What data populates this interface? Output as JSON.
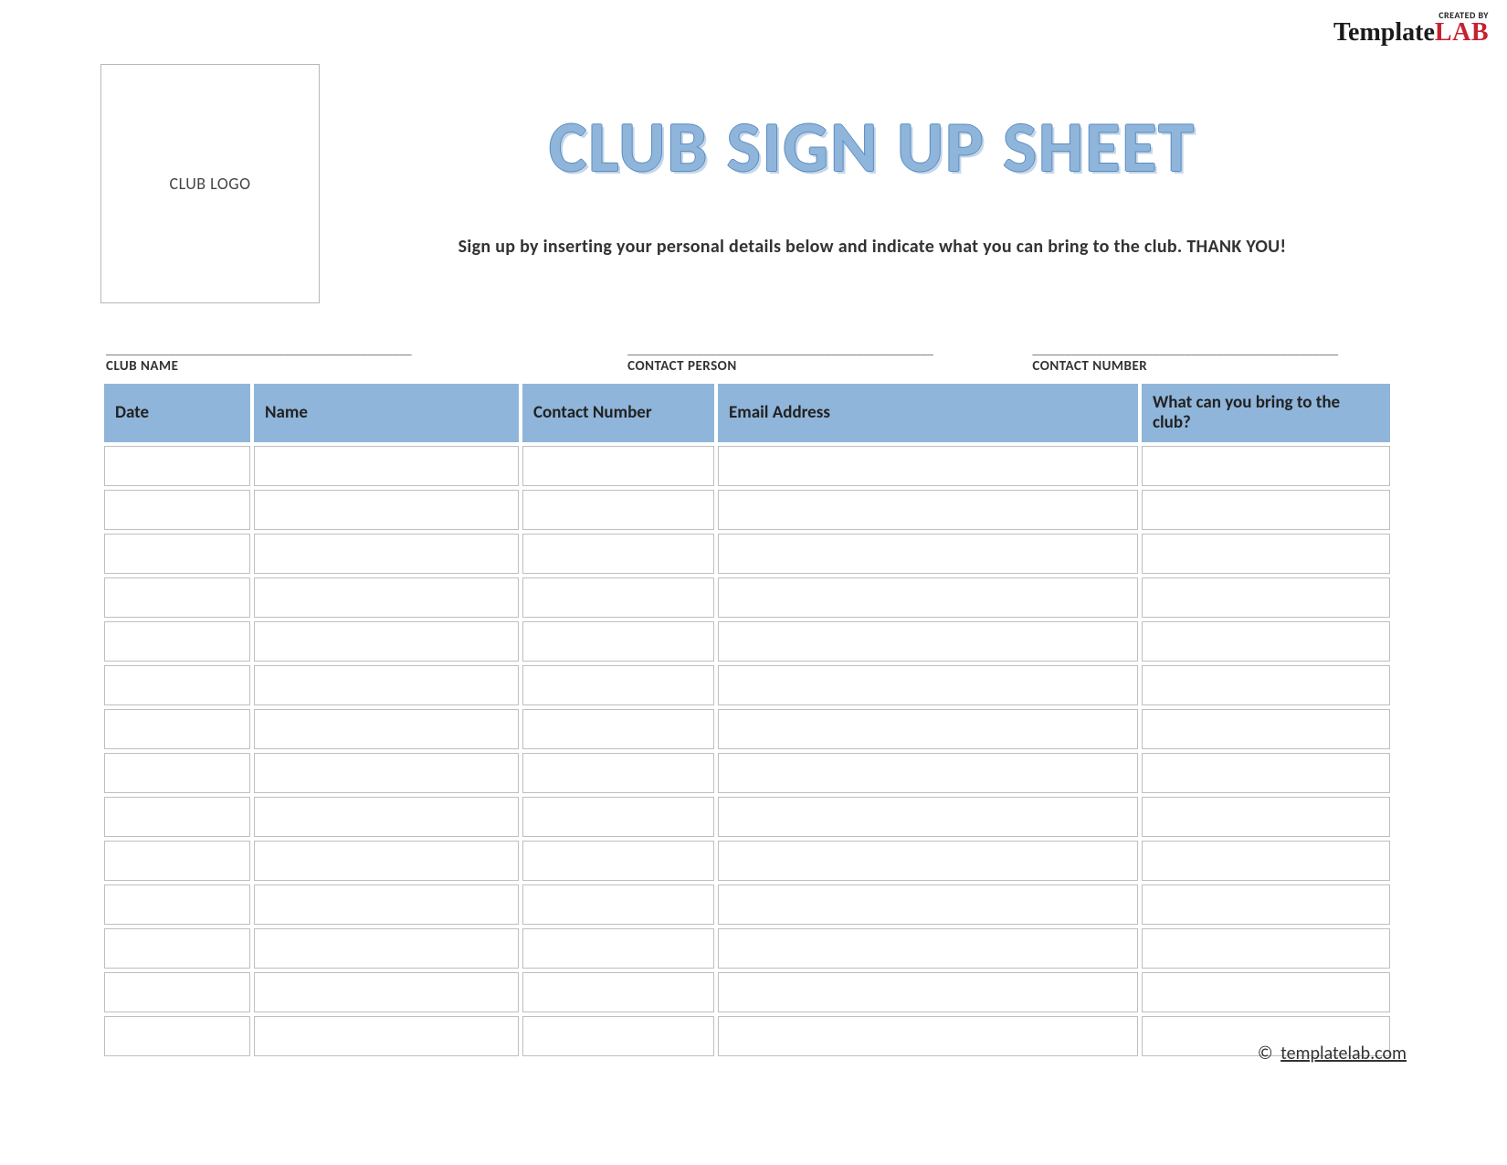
{
  "watermark": {
    "created_by": "CREATED BY",
    "brand_main": "Template",
    "brand_accent": "LAB"
  },
  "header": {
    "logo_placeholder": "CLUB LOGO",
    "title": "CLUB SIGN UP SHEET",
    "instruction": "Sign up by inserting your personal details below and indicate what you can bring to the club. THANK YOU!"
  },
  "meta": {
    "blank_line": "________________________________________________",
    "club_name_label": "CLUB NAME",
    "contact_person_label": "CONTACT PERSON",
    "contact_number_label": "CONTACT NUMBER"
  },
  "table": {
    "headers": {
      "date": "Date",
      "name": "Name",
      "contact_number": "Contact Number",
      "email": "Email Address",
      "bring": "What can you bring to the club?"
    },
    "row_count": 14
  },
  "footer": {
    "copyright": "©",
    "link_text": "templatelab.com"
  }
}
